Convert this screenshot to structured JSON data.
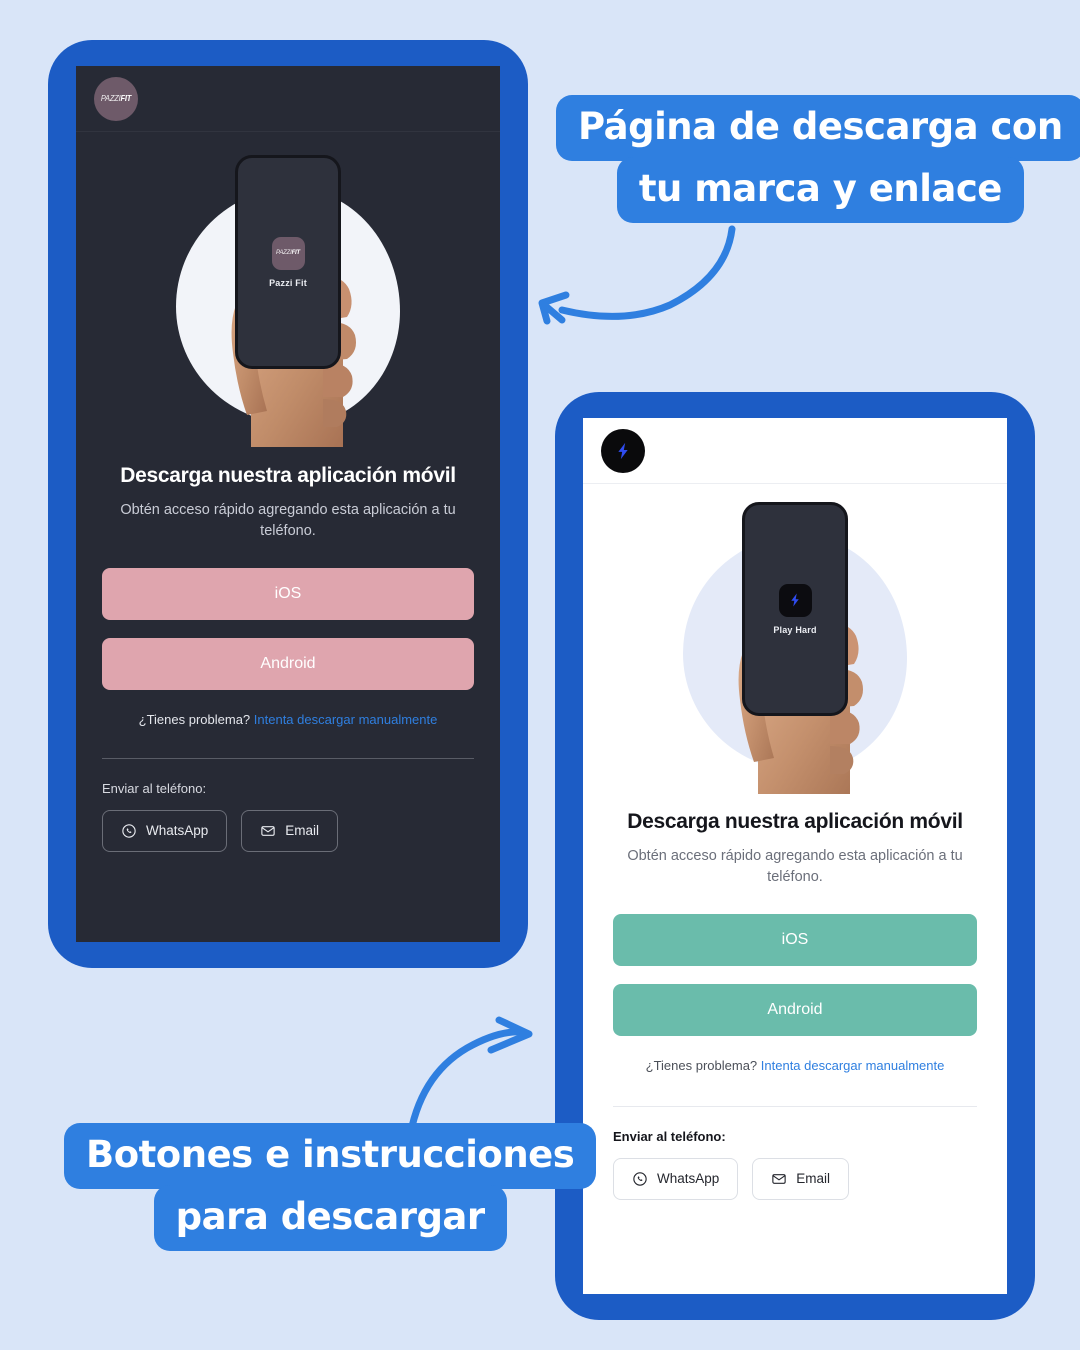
{
  "canvas": {
    "background": "#d9e5f8",
    "frame_color": "#1c5cc5",
    "accent_blue": "#2f7fe0"
  },
  "callouts": [
    {
      "name": "callout-top",
      "line1": "Página de descarga con",
      "line2": "tu marca y enlace",
      "arrow": "curved-arrow-left"
    },
    {
      "name": "callout-bottom",
      "line1": "Botones e instrucciones",
      "line2": "para descargar",
      "arrow": "curved-arrow-right"
    }
  ],
  "cards": [
    {
      "id": "dark-card",
      "theme": "dark",
      "screen_bg": "#272a35",
      "brand": {
        "badge_bg": "#6e5a69",
        "wordmark_thin": "PAZZI",
        "wordmark_bold": "FIT"
      },
      "hero": {
        "blob_color": "#f2f4f9",
        "phone_app_icon_bg": "#6e5a69",
        "phone_app_label": "Pazzi Fit"
      },
      "title": "Descarga nuestra aplicación móvil",
      "subtitle": "Obtén acceso rápido agregando esta aplicación a tu teléfono.",
      "buttons": [
        {
          "label": "iOS",
          "color": "#dfa5ae"
        },
        {
          "label": "Android",
          "color": "#dfa5ae"
        }
      ],
      "manual": {
        "question": "¿Tienes problema?",
        "link": "Intenta descargar manualmente",
        "link_color": "#2f7fe0"
      },
      "send": {
        "label": "Enviar al teléfono:",
        "chips": [
          {
            "label": "WhatsApp",
            "icon": "whatsapp-icon"
          },
          {
            "label": "Email",
            "icon": "envelope-icon"
          }
        ]
      }
    },
    {
      "id": "light-card",
      "theme": "light",
      "screen_bg": "#ffffff",
      "brand": {
        "badge_bg": "#0a0a0c",
        "icon": "lightning-bolt-icon",
        "icon_color": "#2f4cf0"
      },
      "hero": {
        "blob_color": "#e4eaf8",
        "phone_app_icon_bg": "#0c0c10",
        "phone_app_label": "Play Hard"
      },
      "title": "Descarga nuestra aplicación móvil",
      "subtitle": "Obtén acceso rápido agregando esta aplicación a tu teléfono.",
      "buttons": [
        {
          "label": "iOS",
          "color": "#6abcab"
        },
        {
          "label": "Android",
          "color": "#6abcab"
        }
      ],
      "manual": {
        "question": "¿Tienes problema?",
        "link": "Intenta descargar manualmente",
        "link_color": "#2f7fe0"
      },
      "send": {
        "label": "Enviar al teléfono:",
        "chips": [
          {
            "label": "WhatsApp",
            "icon": "whatsapp-icon"
          },
          {
            "label": "Email",
            "icon": "envelope-icon"
          }
        ]
      }
    }
  ]
}
